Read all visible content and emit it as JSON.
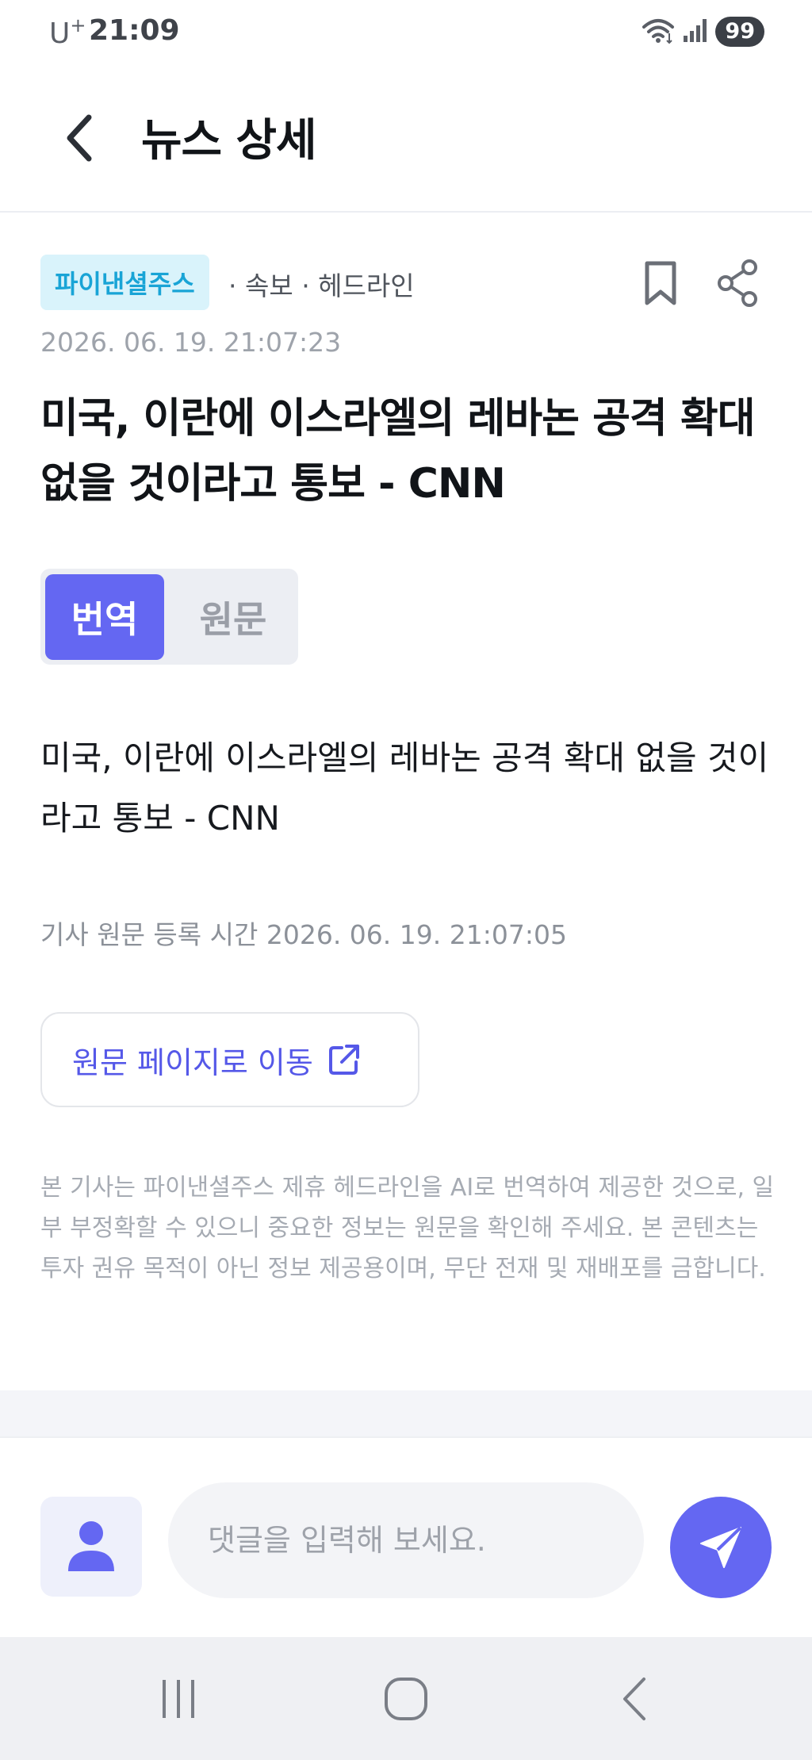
{
  "status_bar": {
    "carrier": "U",
    "carrier_plus": "+",
    "time": "21:09",
    "battery": "99",
    "icons": [
      "wifi-icon",
      "signal-icon"
    ]
  },
  "header": {
    "title": "뉴스 상세",
    "back_icon": "chevron-left-icon"
  },
  "article": {
    "source": "파이낸셜주스",
    "tags": "· 속보 · 헤드라인",
    "date": "2026. 06. 19. 21:07:23",
    "headline": "미국, 이란에 이스라엘의 레바논 공격 확대 없을 것이라고 통보 - CNN",
    "toggle": {
      "translated": "번역",
      "original": "원문",
      "active": "translated"
    },
    "body": "미국, 이란에 이스라엘의 레바논 공격 확대 없을 것이라고 통보 - CNN",
    "register_time": "기사 원문 등록 시간 2026. 06. 19. 21:07:05",
    "original_link_label": "원문 페이지로 이동",
    "disclaimer": "본 기사는 파이낸셜주스 제휴 헤드라인을 AI로 번역하여 제공한 것으로, 일부 부정확할 수 있으니 중요한 정보는 원문을 확인해 주세요. 본 콘텐츠는 투자 권유 목적이 아닌 정보 제공용이며, 무단 전재 및 재배포를 금합니다."
  },
  "comment": {
    "placeholder": "댓글을 입력해 보세요.",
    "value": ""
  },
  "colors": {
    "accent": "#6467f2",
    "source_badge_bg": "#d9f3fb",
    "source_badge_text": "#19a4d6",
    "link_text": "#5558e8"
  }
}
